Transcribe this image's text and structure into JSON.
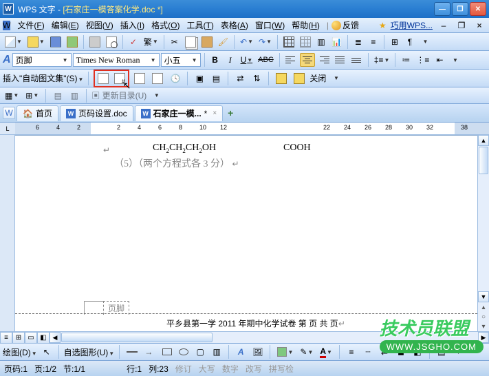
{
  "titlebar": {
    "app_name": "WPS 文字",
    "doc_name": "[石家庄一模答案化学.doc *]"
  },
  "menubar": {
    "items": [
      {
        "label": "文件",
        "u": "F"
      },
      {
        "label": "编辑",
        "u": "E"
      },
      {
        "label": "视图",
        "u": "V"
      },
      {
        "label": "插入",
        "u": "I"
      },
      {
        "label": "格式",
        "u": "O"
      },
      {
        "label": "工具",
        "u": "T"
      },
      {
        "label": "表格",
        "u": "A"
      },
      {
        "label": "窗口",
        "u": "W"
      },
      {
        "label": "帮助",
        "u": "H"
      }
    ],
    "feedback": "反馈",
    "wps_tip": "巧用WPS...",
    "sep": "|"
  },
  "format": {
    "style": "页脚",
    "font": "Times New Roman",
    "size": "小五",
    "bold": "B",
    "italic": "I",
    "underline": "U",
    "abc": "ABC"
  },
  "hf_toolbar": {
    "label": "插入\"自动图文集\"",
    "u": "S",
    "close": "关闭"
  },
  "secondary": {
    "update": "更新目录",
    "u": "U"
  },
  "tabs": {
    "home": "首页",
    "tab1": "页码设置.doc",
    "tab2": "石家庄一模...",
    "tab2_star": "*"
  },
  "ruler": {
    "nums_left": [
      "6",
      "4",
      "2"
    ],
    "nums_right": [
      "2",
      "4",
      "6",
      "8",
      "10",
      "12",
      "22",
      "24",
      "26",
      "28",
      "30",
      "32",
      "38"
    ]
  },
  "document": {
    "chem1": "CH₂CH₂CH₂OH",
    "chem2": "COOH",
    "paragraph": "（5）（两个方程式各 3 分）",
    "footer_label": "页脚",
    "footer_text": "平乡县第一学 2011 年期中化学试卷    第     页  共     页"
  },
  "draw": {
    "label": "绘图",
    "u": "D",
    "autoshape": "自选图形",
    "au": "U"
  },
  "status": {
    "page_num": "页码:1",
    "page": "页:1/2",
    "sec": "节:1/1",
    "line": "行:1",
    "col": "列:23",
    "track": "修订",
    "caps": "大写",
    "num": "数字",
    "ovr": "改写",
    "ime": "拼写检"
  },
  "watermark": {
    "brand": "技术员联盟",
    "url": "WWW.JSGHO.COM"
  }
}
